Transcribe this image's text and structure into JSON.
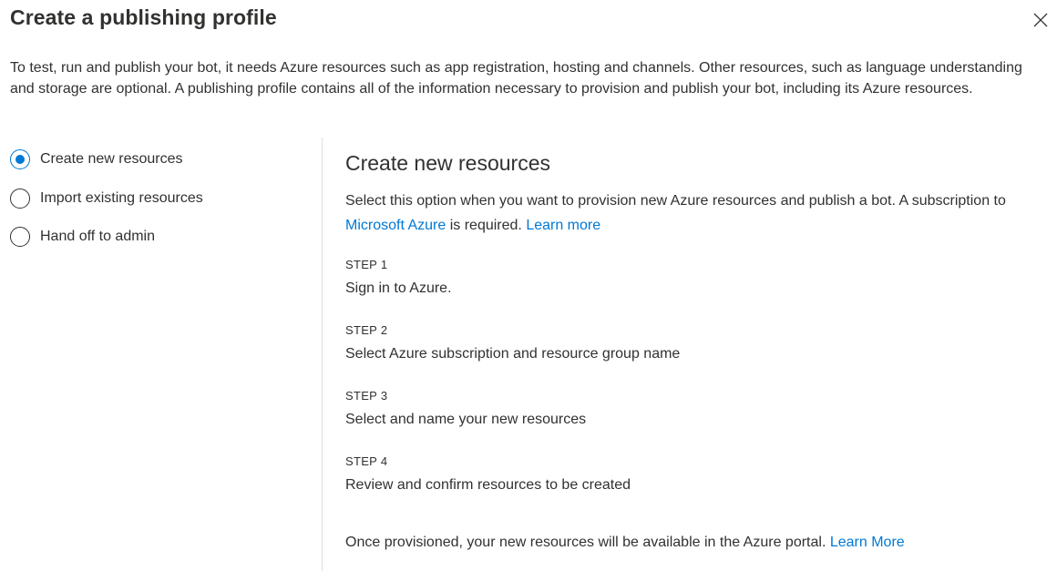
{
  "dialog": {
    "title": "Create a publishing profile",
    "close_icon": "close-icon",
    "intro": "To test, run and publish your bot, it needs Azure resources such as app registration, hosting and channels. Other resources, such as language understanding and storage are optional. A publishing profile contains all of the information necessary to provision and publish your bot, including its Azure resources."
  },
  "options": [
    {
      "label": "Create new resources",
      "selected": true
    },
    {
      "label": "Import existing resources",
      "selected": false
    },
    {
      "label": "Hand off to admin",
      "selected": false
    }
  ],
  "content": {
    "title": "Create new resources",
    "desc_part1": "Select this option when you want to provision new Azure resources and publish a bot. A subscription to ",
    "azure_link": "Microsoft Azure",
    "desc_part2": " is required. ",
    "learn_more_link": "Learn more",
    "steps": [
      {
        "label": "STEP 1",
        "text": "Sign in to Azure."
      },
      {
        "label": "STEP 2",
        "text": "Select Azure subscription and resource group name"
      },
      {
        "label": "STEP 3",
        "text": "Select and name your new resources"
      },
      {
        "label": "STEP 4",
        "text": "Review and confirm resources to be created"
      }
    ],
    "footer_text": "Once provisioned, your new resources will be available in the Azure portal. ",
    "footer_link": "Learn More"
  },
  "colors": {
    "accent": "#0078d4",
    "text": "#323130",
    "divider": "#e1dfdd"
  }
}
